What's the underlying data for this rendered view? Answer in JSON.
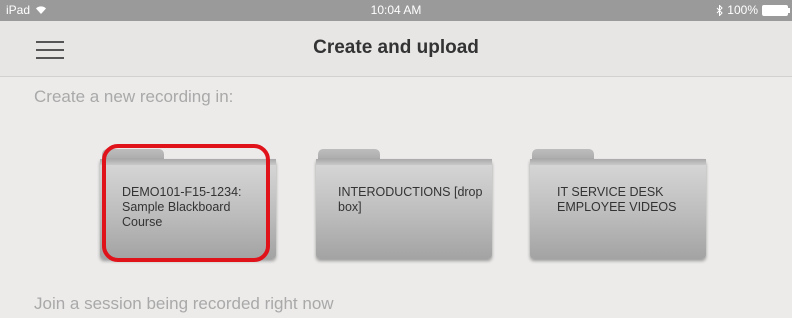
{
  "status_bar": {
    "device": "iPad",
    "wifi_icon": "wifi-icon",
    "time": "10:04 AM",
    "bluetooth_icon": "bluetooth-icon",
    "battery_percent": "100%",
    "battery_level": 1.0
  },
  "navbar": {
    "menu_icon": "hamburger-menu-icon",
    "title": "Create and upload"
  },
  "create_section": {
    "heading": "Create a new recording in:",
    "folders": [
      {
        "label": "DEMO101-F15-1234: Sample Blackboard Course",
        "highlighted": true,
        "icon": "folder-icon"
      },
      {
        "label": "INTERODUCTIONS [drop box]",
        "highlighted": false,
        "icon": "folder-icon"
      },
      {
        "label": "IT SERVICE DESK EMPLOYEE VIDEOS",
        "highlighted": false,
        "icon": "folder-icon"
      }
    ]
  },
  "join_section": {
    "heading": "Join a session being recorded right now"
  },
  "colors": {
    "highlight": "#e0121a",
    "status_bar_bg": "#9a9a9a",
    "background": "#ecebea"
  }
}
